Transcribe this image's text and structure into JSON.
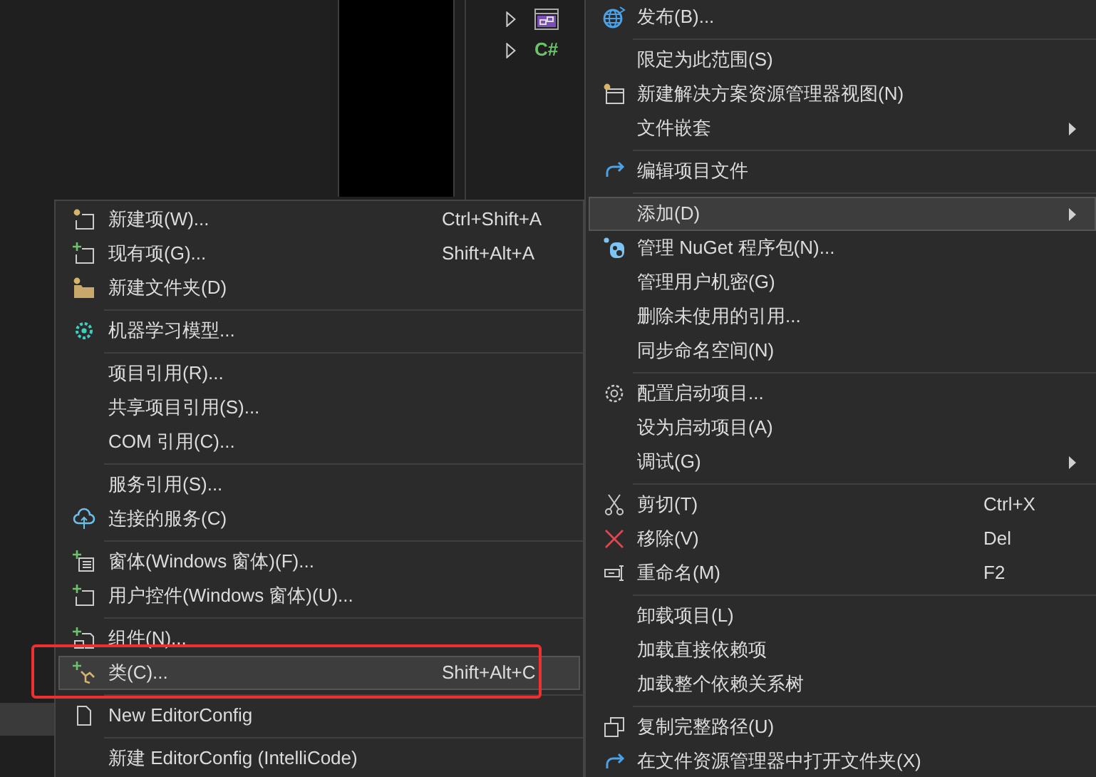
{
  "solution_tree": [
    {
      "expanded": false
    },
    {
      "expanded": false,
      "badge": "C#"
    }
  ],
  "context_menu": [
    {
      "kind": "item",
      "label": "发布(B)...",
      "has_submenu": false,
      "selected": false
    },
    {
      "kind": "separator"
    },
    {
      "kind": "item",
      "label": "限定为此范围(S)",
      "has_submenu": false,
      "selected": false
    },
    {
      "kind": "item",
      "label": "新建解决方案资源管理器视图(N)",
      "has_submenu": false,
      "selected": false
    },
    {
      "kind": "item",
      "label": "文件嵌套",
      "has_submenu": true,
      "selected": false
    },
    {
      "kind": "separator"
    },
    {
      "kind": "item",
      "label": "编辑项目文件",
      "has_submenu": false,
      "selected": false
    },
    {
      "kind": "separator"
    },
    {
      "kind": "item",
      "label": "添加(D)",
      "has_submenu": true,
      "selected": true
    },
    {
      "kind": "item",
      "label": "管理 NuGet 程序包(N)...",
      "has_submenu": false,
      "selected": false
    },
    {
      "kind": "item",
      "label": "管理用户机密(G)",
      "has_submenu": false,
      "selected": false
    },
    {
      "kind": "item",
      "label": "删除未使用的引用...",
      "has_submenu": false,
      "selected": false
    },
    {
      "kind": "item",
      "label": "同步命名空间(N)",
      "has_submenu": false,
      "selected": false
    },
    {
      "kind": "separator"
    },
    {
      "kind": "item",
      "label": "配置启动项目...",
      "has_submenu": false,
      "selected": false
    },
    {
      "kind": "item",
      "label": "设为启动项目(A)",
      "has_submenu": false,
      "selected": false
    },
    {
      "kind": "item",
      "label": "调试(G)",
      "has_submenu": true,
      "selected": false
    },
    {
      "kind": "separator"
    },
    {
      "kind": "item",
      "label": "剪切(T)",
      "shortcut": "Ctrl+X",
      "has_submenu": false,
      "selected": false
    },
    {
      "kind": "item",
      "label": "移除(V)",
      "shortcut": "Del",
      "has_submenu": false,
      "selected": false
    },
    {
      "kind": "item",
      "label": "重命名(M)",
      "shortcut": "F2",
      "has_submenu": false,
      "selected": false
    },
    {
      "kind": "separator"
    },
    {
      "kind": "item",
      "label": "卸载项目(L)",
      "has_submenu": false,
      "selected": false
    },
    {
      "kind": "item",
      "label": "加载直接依赖项",
      "has_submenu": false,
      "selected": false
    },
    {
      "kind": "item",
      "label": "加载整个依赖关系树",
      "has_submenu": false,
      "selected": false
    },
    {
      "kind": "separator"
    },
    {
      "kind": "item",
      "label": "复制完整路径(U)",
      "has_submenu": false,
      "selected": false
    },
    {
      "kind": "item",
      "label": "在文件资源管理器中打开文件夹(X)",
      "has_submenu": false,
      "selected": false
    }
  ],
  "add_submenu": [
    {
      "kind": "item",
      "label": "新建项(W)...",
      "shortcut": "Ctrl+Shift+A",
      "selected": false,
      "circled": false
    },
    {
      "kind": "item",
      "label": "现有项(G)...",
      "shortcut": "Shift+Alt+A",
      "selected": false,
      "circled": false
    },
    {
      "kind": "item",
      "label": "新建文件夹(D)",
      "selected": false,
      "circled": false
    },
    {
      "kind": "separator"
    },
    {
      "kind": "item",
      "label": "机器学习模型...",
      "selected": false,
      "circled": false
    },
    {
      "kind": "separator"
    },
    {
      "kind": "item",
      "label": "项目引用(R)...",
      "selected": false,
      "circled": false
    },
    {
      "kind": "item",
      "label": "共享项目引用(S)...",
      "selected": false,
      "circled": false
    },
    {
      "kind": "item",
      "label": "COM 引用(C)...",
      "selected": false,
      "circled": false
    },
    {
      "kind": "separator"
    },
    {
      "kind": "item",
      "label": "服务引用(S)...",
      "selected": false,
      "circled": false
    },
    {
      "kind": "item",
      "label": "连接的服务(C)",
      "selected": false,
      "circled": false
    },
    {
      "kind": "separator"
    },
    {
      "kind": "item",
      "label": "窗体(Windows 窗体)(F)...",
      "selected": false,
      "circled": false
    },
    {
      "kind": "item",
      "label": "用户控件(Windows 窗体)(U)...",
      "selected": false,
      "circled": false
    },
    {
      "kind": "separator"
    },
    {
      "kind": "item",
      "label": "组件(N)...",
      "selected": false,
      "circled": false
    },
    {
      "kind": "item",
      "label": "类(C)...",
      "shortcut": "Shift+Alt+C",
      "selected": true,
      "circled": true
    },
    {
      "kind": "separator"
    },
    {
      "kind": "item",
      "label": "New EditorConfig",
      "selected": false,
      "circled": false
    },
    {
      "kind": "separator"
    },
    {
      "kind": "item",
      "label": "新建 EditorConfig (IntelliCode)",
      "selected": false,
      "circled": false
    }
  ]
}
